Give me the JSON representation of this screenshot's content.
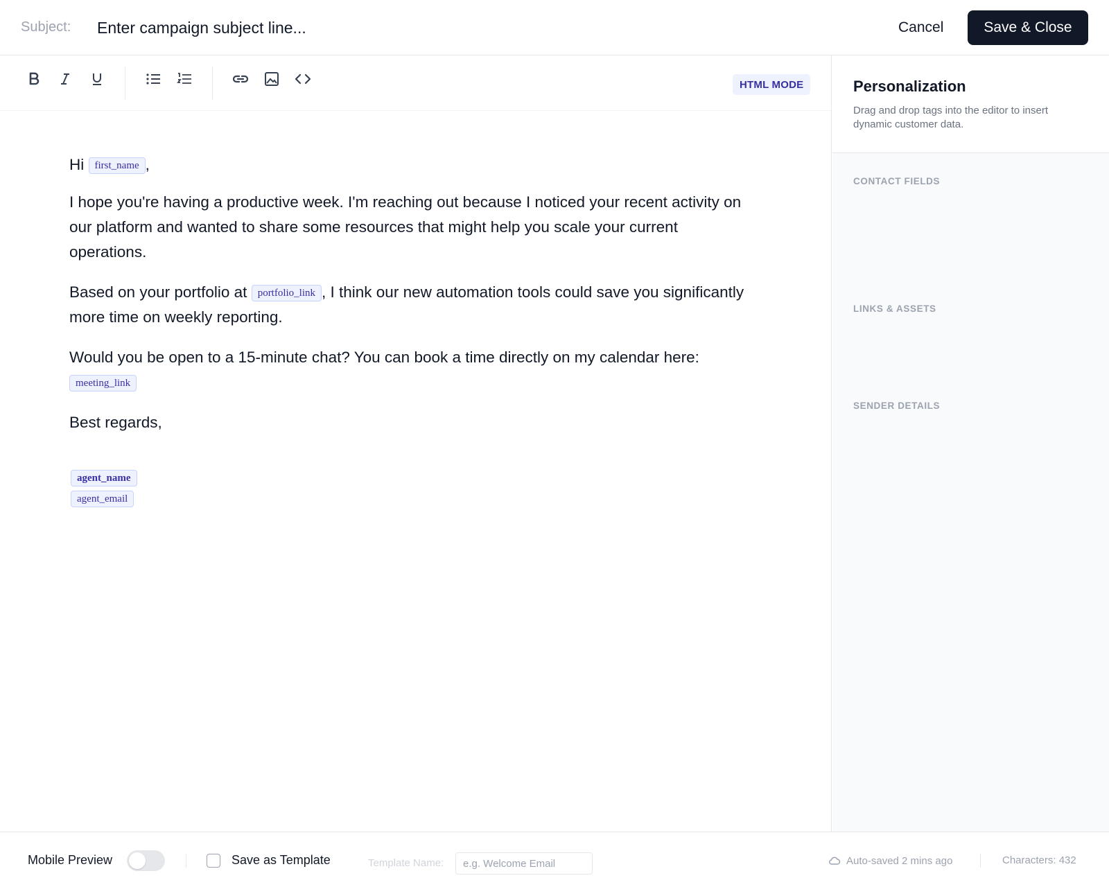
{
  "header": {
    "subject_label": "Subject:",
    "subject_placeholder": "Enter campaign subject line...",
    "cancel_label": "Cancel",
    "save_label": "Save & Close"
  },
  "toolbar": {
    "icons": [
      "bold-icon",
      "italic-icon",
      "underline-icon",
      "bullet-list-icon",
      "numbered-list-icon",
      "link-icon",
      "image-icon",
      "code-icon"
    ],
    "html_mode_label": "HTML MODE"
  },
  "email": {
    "greeting_prefix": "Hi",
    "first_name_tag": "first_name",
    "greeting_suffix": ",",
    "para1": "I hope you're having a productive week. I'm reaching out because I noticed your recent activity on our platform and wanted to share some resources that might help you scale your current operations.",
    "para2_prefix": "Based on your portfolio at",
    "portfolio_tag": "portfolio_link",
    "para2_suffix": ", I think our new automation tools could save you significantly more time on weekly reporting.",
    "para3": "Would you be open to a 15-minute chat? You can book a time directly on my calendar here:",
    "meeting_tag": "meeting_link",
    "closing": "Best regards,",
    "agent_name_tag": "agent_name",
    "agent_email_tag": "agent_email"
  },
  "sidebar": {
    "title": "Personalization",
    "description": "Drag and drop tags into the editor to insert dynamic customer data.",
    "sections": [
      "CONTACT FIELDS",
      "LINKS & ASSETS",
      "SENDER DETAILS"
    ]
  },
  "footer": {
    "mobile_preview_label": "Mobile Preview",
    "mobile_preview_on": false,
    "save_template_label": "Save as Template",
    "save_template_checked": false,
    "template_name_label": "Template Name:",
    "template_name_placeholder": "e.g. Welcome Email",
    "autosave_text": "Auto-saved 2 mins ago",
    "characters_text": "Characters: 432"
  },
  "colors": {
    "primary_dark": "#111827",
    "tag_bg": "#eef2ff",
    "tag_text": "#3730a3",
    "muted": "#9ca3af"
  }
}
